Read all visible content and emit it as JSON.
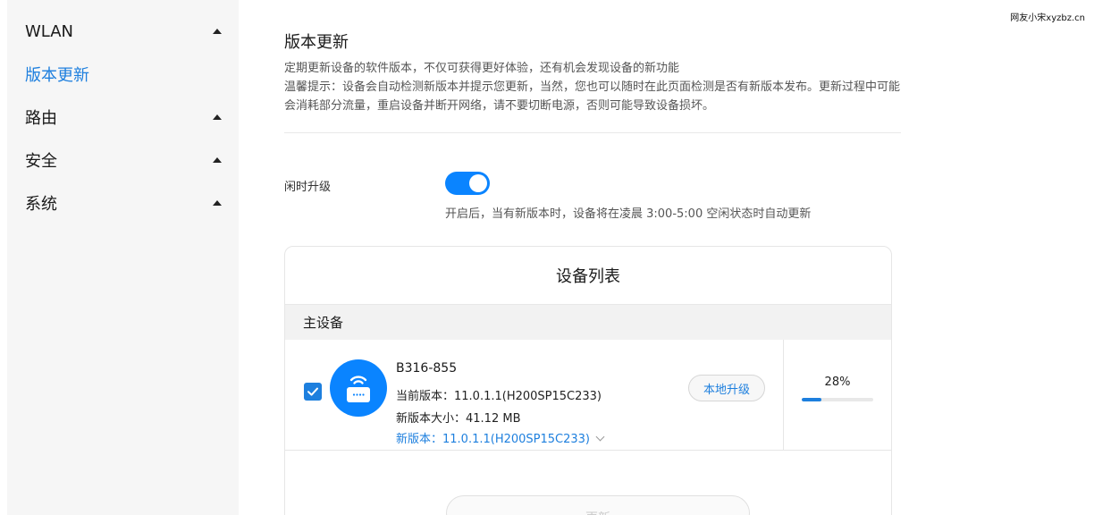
{
  "watermark": "网友小宋xyzbz.cn",
  "sidebar": {
    "items": [
      {
        "label": "WLAN",
        "expandable": true,
        "active": false
      },
      {
        "label": "版本更新",
        "expandable": false,
        "active": true
      },
      {
        "label": "路由",
        "expandable": true,
        "active": false
      },
      {
        "label": "安全",
        "expandable": true,
        "active": false
      },
      {
        "label": "系统",
        "expandable": true,
        "active": false
      }
    ]
  },
  "main": {
    "title": "版本更新",
    "description_line1": "定期更新设备的软件版本，不仅可获得更好体验，还有机会发现设备的新功能",
    "description_line2": "温馨提示：设备会自动检测新版本并提示您更新，当然，您也可以随时在此页面检测是否有新版本发布。更新过程中可能会消耗部分流量，重启设备并断开网络，请不要切断电源，否则可能导致设备损坏。",
    "idle_upgrade": {
      "label": "闲时升级",
      "enabled": true,
      "hint": "开启后，当有新版本时，设备将在凌晨 3:00-5:00 空闲状态时自动更新"
    },
    "device_list": {
      "title": "设备列表",
      "section": "主设备",
      "device": {
        "checked": true,
        "name": "B316-855",
        "current_version": "当前版本：11.0.1.1(H200SP15C233)",
        "package_size": "新版本大小：41.12 MB",
        "new_version": "新版本：11.0.1.1(H200SP15C233)",
        "local_upgrade_label": "本地升级",
        "progress_text": "28%",
        "progress": 0.28
      },
      "update_button": "更新"
    }
  },
  "colors": {
    "accent": "#1d7fde",
    "toggle_on": "#0a84ff",
    "sidebar_bg": "#f6f6f6"
  }
}
